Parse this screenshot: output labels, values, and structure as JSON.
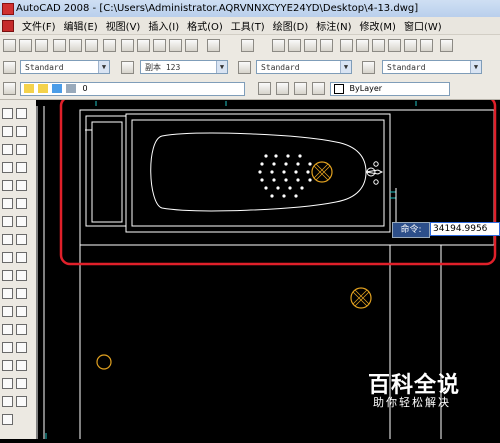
{
  "window": {
    "title": "AutoCAD 2008 - [C:\\Users\\Administrator.AQRVNNXCYYE24YD\\Desktop\\4-13.dwg]"
  },
  "menubar": {
    "items": [
      "文件(F)",
      "编辑(E)",
      "视图(V)",
      "插入(I)",
      "格式(O)",
      "工具(T)",
      "绘图(D)",
      "标注(N)",
      "修改(M)",
      "窗口(W)"
    ]
  },
  "styles_toolbar": {
    "text_style": "Standard",
    "dim_style": "副本 123",
    "table_style": "Standard",
    "mleader_style": "Standard"
  },
  "layers_toolbar": {
    "current_layer": "0",
    "color": "ByLayer"
  },
  "command": {
    "label": "命令:",
    "value": "34194.9956"
  },
  "watermark": {
    "title": "百科全说",
    "subtitle": "助你轻松解决"
  },
  "colors": {
    "highlight": "#e0202a",
    "hatch": "#e0a020",
    "linework": "#ffffff",
    "accent_cyan": "#20c0c0"
  }
}
